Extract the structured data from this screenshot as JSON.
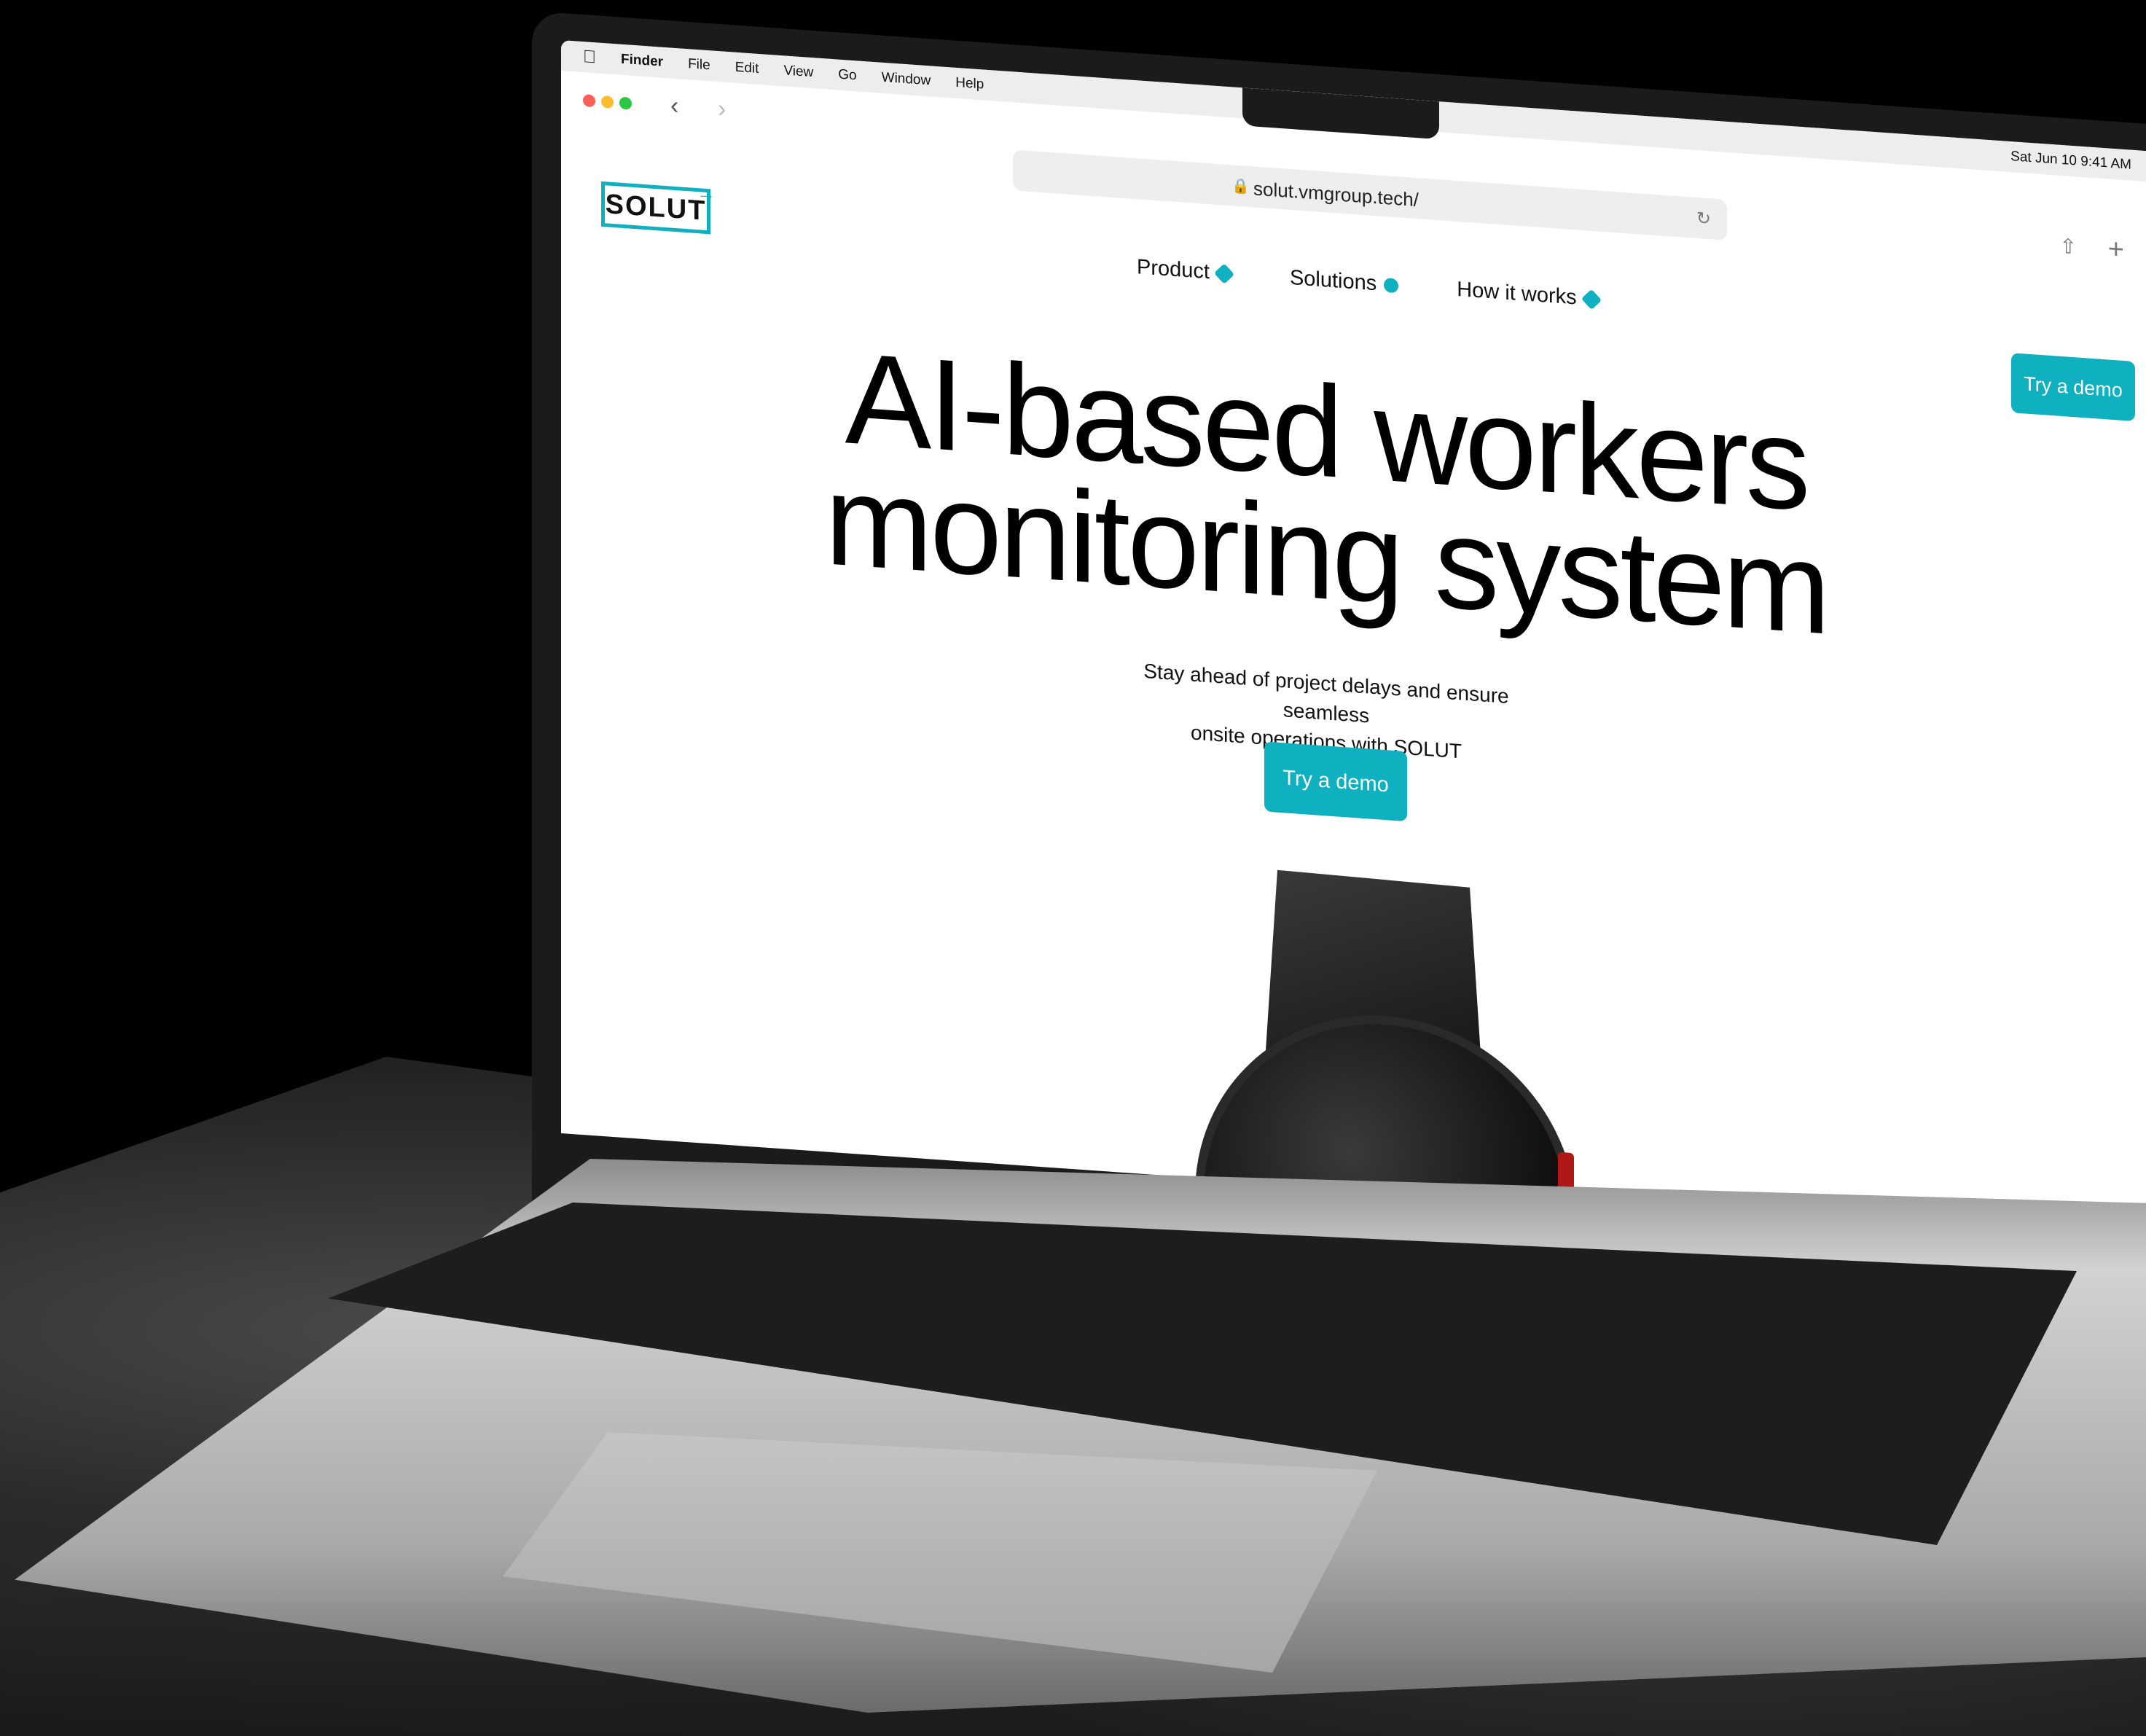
{
  "menubar": {
    "apple_icon": "apple-icon",
    "items": [
      "Finder",
      "File",
      "Edit",
      "View",
      "Go",
      "Window",
      "Help"
    ],
    "clock": "Sat Jun 10  9:41 AM"
  },
  "browser": {
    "url": "solut.vmgroup.tech/",
    "lock_icon": "lock-icon",
    "reload_icon": "reload-icon",
    "share_icon": "share-icon",
    "new_tab_icon": "plus-icon"
  },
  "site": {
    "logo": "SOLUT",
    "nav": [
      {
        "label": "Product"
      },
      {
        "label": "Solutions"
      },
      {
        "label": "How it works"
      }
    ],
    "cta_top": "Try a demo",
    "hero_line1": "AI-based workers",
    "hero_line2": "monitoring system",
    "subtitle_line1": "Stay ahead of project delays and ensure seamless",
    "subtitle_line2": "onsite operations with SOLUT",
    "cta_main": "Try a demo",
    "accent_color": "#0fb0c0"
  }
}
